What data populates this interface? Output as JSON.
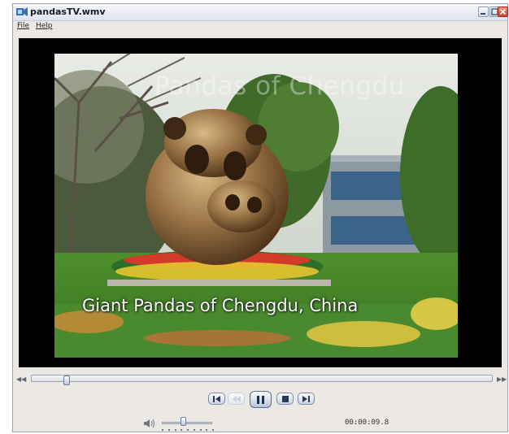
{
  "window": {
    "title": "pandasTV.wmv"
  },
  "menu": [
    {
      "label": "File",
      "accesskey": "F"
    },
    {
      "label": "Help",
      "accesskey": "H"
    }
  ],
  "video": {
    "top_caption": "Pandas of Chengdu",
    "main_caption": "Giant Pandas of Chengdu, China"
  },
  "seekbar": {
    "position_fraction": 0.07
  },
  "controls": {
    "buttons": [
      "previous",
      "rewind",
      "pause",
      "stop",
      "next"
    ],
    "disabled": [
      "rewind"
    ]
  },
  "volume": {
    "level_fraction": 0.42
  },
  "time": "00:00:09.8",
  "icons": {
    "app": "media-player-icon",
    "minimize": "minimize-icon",
    "maximize": "maximize-icon",
    "close": "close-icon",
    "seek_back": "seek-back-icon",
    "seek_forward": "seek-forward-icon",
    "volume": "speaker-icon"
  }
}
